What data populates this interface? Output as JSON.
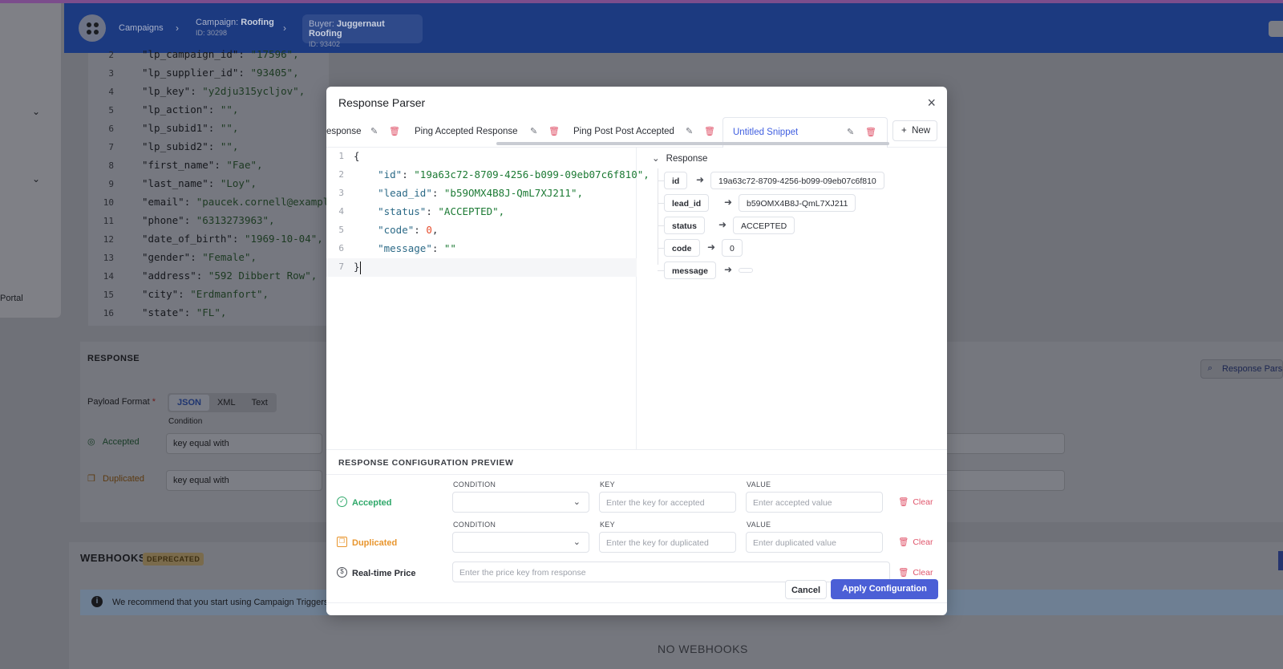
{
  "topbar": {
    "breadcrumbs": [
      {
        "label": "Campaigns"
      },
      {
        "prefix": "Campaign:",
        "name": "Roofing",
        "sub": "ID: 30298"
      },
      {
        "prefix": "Buyer:",
        "name": "Juggernaut Roofing",
        "sub": "ID: 93402"
      }
    ]
  },
  "left_panel": {
    "portal_label": "Portal"
  },
  "background_code": [
    {
      "n": "2",
      "k": "\"lp_campaign_id\"",
      "v": "\"17596\","
    },
    {
      "n": "3",
      "k": "\"lp_supplier_id\"",
      "v": "\"93405\","
    },
    {
      "n": "4",
      "k": "\"lp_key\"",
      "v": "\"y2dju315ycljov\","
    },
    {
      "n": "5",
      "k": "\"lp_action\"",
      "v": "\"\","
    },
    {
      "n": "6",
      "k": "\"lp_subid1\"",
      "v": "\"\","
    },
    {
      "n": "7",
      "k": "\"lp_subid2\"",
      "v": "\"\","
    },
    {
      "n": "8",
      "k": "\"first_name\"",
      "v": "\"Fae\","
    },
    {
      "n": "9",
      "k": "\"last_name\"",
      "v": "\"Loy\","
    },
    {
      "n": "10",
      "k": "\"email\"",
      "v": "\"paucek.cornell@example"
    },
    {
      "n": "11",
      "k": "\"phone\"",
      "v": "\"6313273963\","
    },
    {
      "n": "12",
      "k": "\"date_of_birth\"",
      "v": "\"1969-10-04\","
    },
    {
      "n": "13",
      "k": "\"gender\"",
      "v": "\"Female\","
    },
    {
      "n": "14",
      "k": "\"address\"",
      "v": "\"592 Dibbert Row\","
    },
    {
      "n": "15",
      "k": "\"city\"",
      "v": "\"Erdmanfort\","
    },
    {
      "n": "16",
      "k": "\"state\"",
      "v": "\"FL\","
    }
  ],
  "response_section": {
    "title": "RESPONSE",
    "payload_format_label": "Payload Format",
    "required_mark": "*",
    "formats": [
      "JSON",
      "XML",
      "Text"
    ],
    "condition_label": "Condition",
    "accepted_label": "Accepted",
    "duplicated_label": "Duplicated",
    "accepted_condition": "key equal with",
    "duplicated_condition": "key equal with",
    "response_parser_button": "Response Parser"
  },
  "webhooks": {
    "title": "WEBHOOKS",
    "badge": "DEPRECATED",
    "info": "We recommend that you start using Campaign Triggers.",
    "empty": "NO WEBHOOKS"
  },
  "modal": {
    "title": "Response Parser",
    "close": "×",
    "tabs": [
      "esponse",
      "Ping Accepted Response",
      "Ping Post Post Accepted",
      "Untitled Snippet"
    ],
    "new_label": "New",
    "editor_lines": [
      {
        "n": "1",
        "text": "{"
      },
      {
        "n": "2",
        "key": "\"id\"",
        "val": "\"19a63c72-8709-4256-b099-09eb07c6f810\","
      },
      {
        "n": "3",
        "key": "\"lead_id\"",
        "val": "\"b59OMX4B8J-QmL7XJ211\","
      },
      {
        "n": "4",
        "key": "\"status\"",
        "val": "\"ACCEPTED\","
      },
      {
        "n": "5",
        "key": "\"code\"",
        "num": "0",
        "tail": ","
      },
      {
        "n": "6",
        "key": "\"message\"",
        "val": "\"\""
      },
      {
        "n": "7",
        "text": "}"
      }
    ],
    "tree": {
      "root": "Response",
      "items": [
        {
          "key": "id",
          "value": "19a63c72-8709-4256-b099-09eb07c6f810"
        },
        {
          "key": "lead_id",
          "value": "b59OMX4B8J-QmL7XJ211"
        },
        {
          "key": "status",
          "value": "ACCEPTED"
        },
        {
          "key": "code",
          "value": "0"
        },
        {
          "key": "message",
          "value": ""
        }
      ]
    },
    "config": {
      "title": "RESPONSE CONFIGURATION PREVIEW",
      "col_condition": "CONDITION",
      "col_key": "KEY",
      "col_value": "VALUE",
      "accepted_label": "Accepted",
      "accepted_key_placeholder": "Enter the key for accepted",
      "accepted_value_placeholder": "Enter accepted value",
      "duplicated_label": "Duplicated",
      "duplicated_key_placeholder": "Enter the key for duplicated",
      "duplicated_value_placeholder": "Enter duplicated value",
      "price_label": "Real-time Price",
      "price_placeholder": "Enter the price key from response",
      "clear_label": "Clear"
    },
    "cancel_label": "Cancel",
    "apply_label": "Apply Configuration"
  },
  "colors": {
    "primary": "#4b5fd6",
    "accepted": "#2fa86a",
    "duplicated": "#e8952d",
    "danger": "#e0556b"
  }
}
